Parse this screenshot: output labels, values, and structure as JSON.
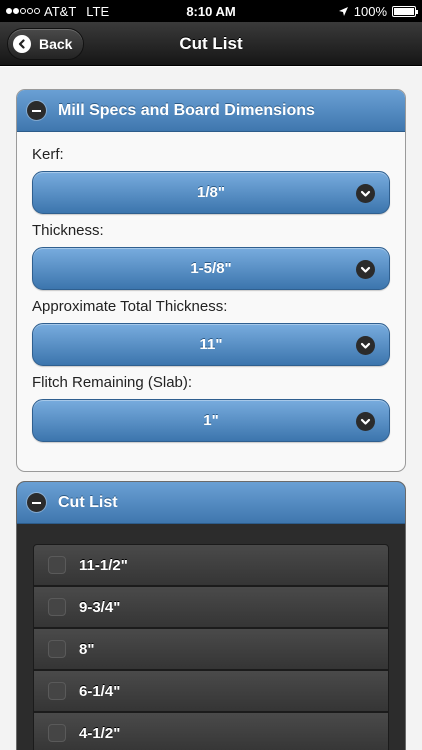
{
  "status_bar": {
    "carrier": "AT&T",
    "network": "LTE",
    "time": "8:10 AM",
    "battery": "100%",
    "signal_bars_filled": 2,
    "signal_bars_total": 5
  },
  "nav": {
    "back_label": "Back",
    "title": "Cut List"
  },
  "specs": {
    "header": "Mill Specs and Board Dimensions",
    "fields": [
      {
        "label": "Kerf:",
        "value": "1/8\""
      },
      {
        "label": "Thickness:",
        "value": "1-5/8\""
      },
      {
        "label": "Approximate Total Thickness:",
        "value": "11\""
      },
      {
        "label": "Flitch Remaining (Slab):",
        "value": "1\""
      }
    ]
  },
  "cutlist": {
    "header": "Cut List",
    "items": [
      "11-1/2\"",
      "9-3/4\"",
      "8\"",
      "6-1/4\"",
      "4-1/2\""
    ]
  },
  "colors": {
    "accent_blue": "#4a84bd",
    "nav_dark": "#1f1f1f",
    "list_dark": "#2c2c2c"
  },
  "icons": {
    "back": "chevron-left-icon",
    "collapse": "minus-icon",
    "select": "chevron-down-icon",
    "checkbox": "checkbox-icon"
  }
}
